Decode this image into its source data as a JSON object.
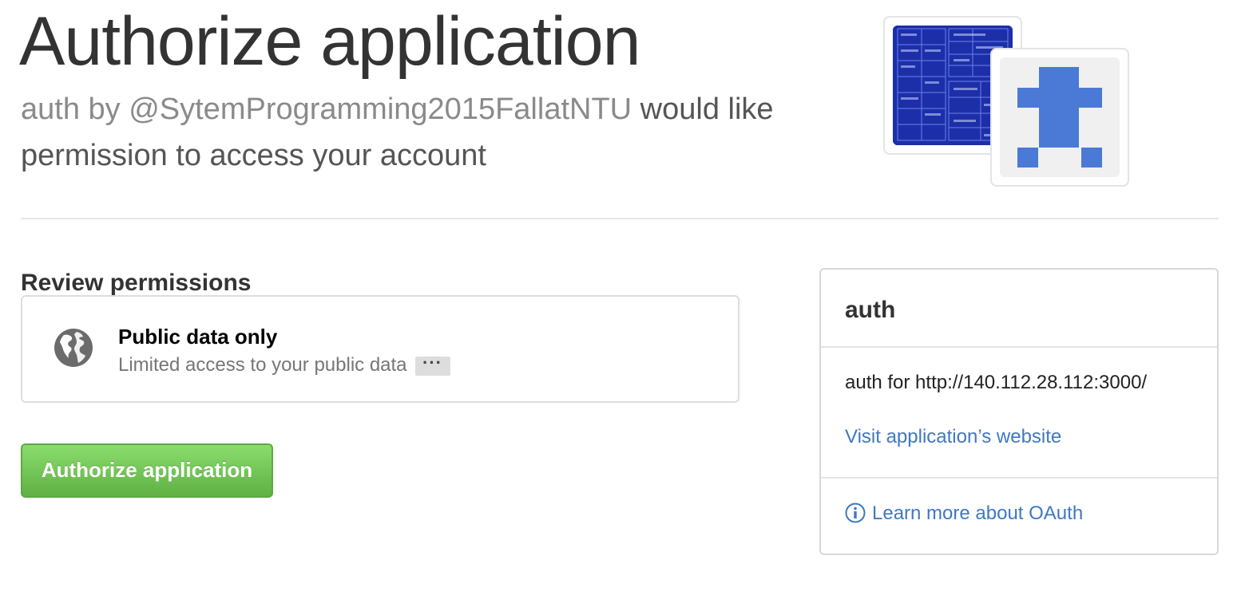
{
  "header": {
    "title": "Authorize application",
    "app_by": "auth by @SytemProgramming2015FallatNTU",
    "request_text": "would like permission to access your account"
  },
  "avatars": {
    "app_avatar_icon": "blueprint-image-icon",
    "user_avatar_icon": "identicon-icon",
    "identicon_color": "#4a7ad6"
  },
  "permissions": {
    "heading": "Review permissions",
    "items": [
      {
        "icon": "globe-icon",
        "title": "Public data only",
        "description": "Limited access to your public data",
        "more_label": "···"
      }
    ]
  },
  "authorize_button": {
    "label": "Authorize application",
    "color": "#60b044"
  },
  "app_info": {
    "name": "auth",
    "description": "auth for http://140.112.28.112:3000/",
    "website_link": "Visit application’s website",
    "oauth_link": "Learn more about OAuth",
    "link_color": "#4078c0"
  }
}
